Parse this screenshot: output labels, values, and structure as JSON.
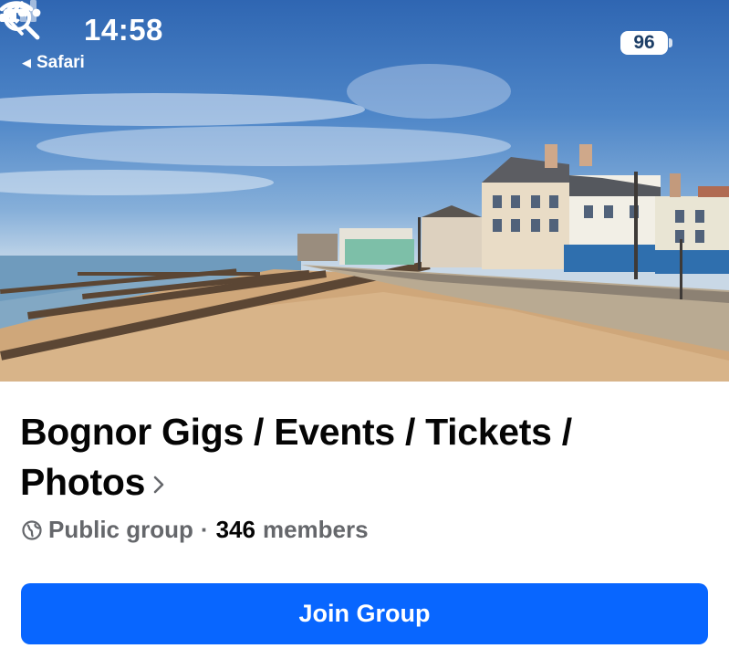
{
  "status_bar": {
    "time": "14:58",
    "back_app": "Safari",
    "battery": "96"
  },
  "header": {
    "icons": [
      "back-icon",
      "search-icon",
      "more-icon"
    ]
  },
  "group": {
    "title": "Bognor Gigs / Events / Tickets / Photos",
    "privacy": "Public group",
    "separator": "·",
    "member_count": "346",
    "members_label": "members"
  },
  "actions": {
    "join_label": "Join Group"
  },
  "colors": {
    "join_button": "#0866ff",
    "meta_text": "#65676b",
    "title_text": "#050505"
  }
}
